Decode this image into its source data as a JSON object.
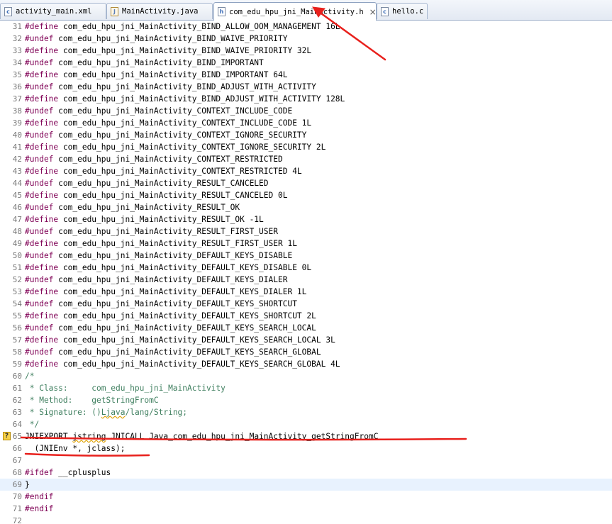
{
  "tabs": [
    {
      "label": "activity_main.xml",
      "icon": "c-file-icon",
      "active": false
    },
    {
      "label": "MainActivity.java",
      "icon": "java-file-icon",
      "active": false
    },
    {
      "label": "com_edu_hpu_jni_MainActivity.h",
      "icon": "h-file-icon",
      "active": true,
      "close": "×"
    },
    {
      "label": "hello.c",
      "icon": "c-file-icon",
      "active": false
    }
  ],
  "code_lines": [
    {
      "n": "31",
      "kw": "#define",
      "rest": " com_edu_hpu_jni_MainActivity_BIND_ALLOW_OOM_MANAGEMENT 16L"
    },
    {
      "n": "32",
      "kw": "#undef",
      "rest": " com_edu_hpu_jni_MainActivity_BIND_WAIVE_PRIORITY"
    },
    {
      "n": "33",
      "kw": "#define",
      "rest": " com_edu_hpu_jni_MainActivity_BIND_WAIVE_PRIORITY 32L"
    },
    {
      "n": "34",
      "kw": "#undef",
      "rest": " com_edu_hpu_jni_MainActivity_BIND_IMPORTANT"
    },
    {
      "n": "35",
      "kw": "#define",
      "rest": " com_edu_hpu_jni_MainActivity_BIND_IMPORTANT 64L"
    },
    {
      "n": "36",
      "kw": "#undef",
      "rest": " com_edu_hpu_jni_MainActivity_BIND_ADJUST_WITH_ACTIVITY"
    },
    {
      "n": "37",
      "kw": "#define",
      "rest": " com_edu_hpu_jni_MainActivity_BIND_ADJUST_WITH_ACTIVITY 128L"
    },
    {
      "n": "38",
      "kw": "#undef",
      "rest": " com_edu_hpu_jni_MainActivity_CONTEXT_INCLUDE_CODE"
    },
    {
      "n": "39",
      "kw": "#define",
      "rest": " com_edu_hpu_jni_MainActivity_CONTEXT_INCLUDE_CODE 1L"
    },
    {
      "n": "40",
      "kw": "#undef",
      "rest": " com_edu_hpu_jni_MainActivity_CONTEXT_IGNORE_SECURITY"
    },
    {
      "n": "41",
      "kw": "#define",
      "rest": " com_edu_hpu_jni_MainActivity_CONTEXT_IGNORE_SECURITY 2L"
    },
    {
      "n": "42",
      "kw": "#undef",
      "rest": " com_edu_hpu_jni_MainActivity_CONTEXT_RESTRICTED"
    },
    {
      "n": "43",
      "kw": "#define",
      "rest": " com_edu_hpu_jni_MainActivity_CONTEXT_RESTRICTED 4L"
    },
    {
      "n": "44",
      "kw": "#undef",
      "rest": " com_edu_hpu_jni_MainActivity_RESULT_CANCELED"
    },
    {
      "n": "45",
      "kw": "#define",
      "rest": " com_edu_hpu_jni_MainActivity_RESULT_CANCELED 0L"
    },
    {
      "n": "46",
      "kw": "#undef",
      "rest": " com_edu_hpu_jni_MainActivity_RESULT_OK"
    },
    {
      "n": "47",
      "kw": "#define",
      "rest": " com_edu_hpu_jni_MainActivity_RESULT_OK -1L"
    },
    {
      "n": "48",
      "kw": "#undef",
      "rest": " com_edu_hpu_jni_MainActivity_RESULT_FIRST_USER"
    },
    {
      "n": "49",
      "kw": "#define",
      "rest": " com_edu_hpu_jni_MainActivity_RESULT_FIRST_USER 1L"
    },
    {
      "n": "50",
      "kw": "#undef",
      "rest": " com_edu_hpu_jni_MainActivity_DEFAULT_KEYS_DISABLE"
    },
    {
      "n": "51",
      "kw": "#define",
      "rest": " com_edu_hpu_jni_MainActivity_DEFAULT_KEYS_DISABLE 0L"
    },
    {
      "n": "52",
      "kw": "#undef",
      "rest": " com_edu_hpu_jni_MainActivity_DEFAULT_KEYS_DIALER"
    },
    {
      "n": "53",
      "kw": "#define",
      "rest": " com_edu_hpu_jni_MainActivity_DEFAULT_KEYS_DIALER 1L"
    },
    {
      "n": "54",
      "kw": "#undef",
      "rest": " com_edu_hpu_jni_MainActivity_DEFAULT_KEYS_SHORTCUT"
    },
    {
      "n": "55",
      "kw": "#define",
      "rest": " com_edu_hpu_jni_MainActivity_DEFAULT_KEYS_SHORTCUT 2L"
    },
    {
      "n": "56",
      "kw": "#undef",
      "rest": " com_edu_hpu_jni_MainActivity_DEFAULT_KEYS_SEARCH_LOCAL"
    },
    {
      "n": "57",
      "kw": "#define",
      "rest": " com_edu_hpu_jni_MainActivity_DEFAULT_KEYS_SEARCH_LOCAL 3L"
    },
    {
      "n": "58",
      "kw": "#undef",
      "rest": " com_edu_hpu_jni_MainActivity_DEFAULT_KEYS_SEARCH_GLOBAL"
    },
    {
      "n": "59",
      "kw": "#define",
      "rest": " com_edu_hpu_jni_MainActivity_DEFAULT_KEYS_SEARCH_GLOBAL 4L"
    },
    {
      "n": "60",
      "cm": "/*"
    },
    {
      "n": "61",
      "cm": " * Class:     com_edu_hpu_jni_MainActivity"
    },
    {
      "n": "62",
      "cm": " * Method:    getStringFromC"
    },
    {
      "n": "63",
      "cm_pre": " * Signature: ()",
      "cm_wavy": "Ljava",
      "cm_post": "/lang/String;"
    },
    {
      "n": "64",
      "cm": " */"
    },
    {
      "n": "65",
      "pre": "JNIEXPORT ",
      "wavy": "jstring",
      "post": " JNICALL Java_com_edu_hpu_jni_MainActivity_getStringFromC",
      "marker": "?"
    },
    {
      "n": "66",
      "plain": "  (JNIEnv *, jclass);"
    },
    {
      "n": "67",
      "plain": ""
    },
    {
      "n": "68",
      "kw": "#ifdef",
      "rest": " __cplusplus"
    },
    {
      "n": "69",
      "plain": "}",
      "current": true
    },
    {
      "n": "70",
      "kw": "#endif",
      "rest": ""
    },
    {
      "n": "71",
      "kw": "#endif",
      "rest": ""
    },
    {
      "n": "72",
      "plain": ""
    }
  ],
  "colors": {
    "annotation": "#e8201c",
    "preprocessor": "#7f0055",
    "comment": "#3f7f5f",
    "current_line": "#e8f2fe"
  }
}
